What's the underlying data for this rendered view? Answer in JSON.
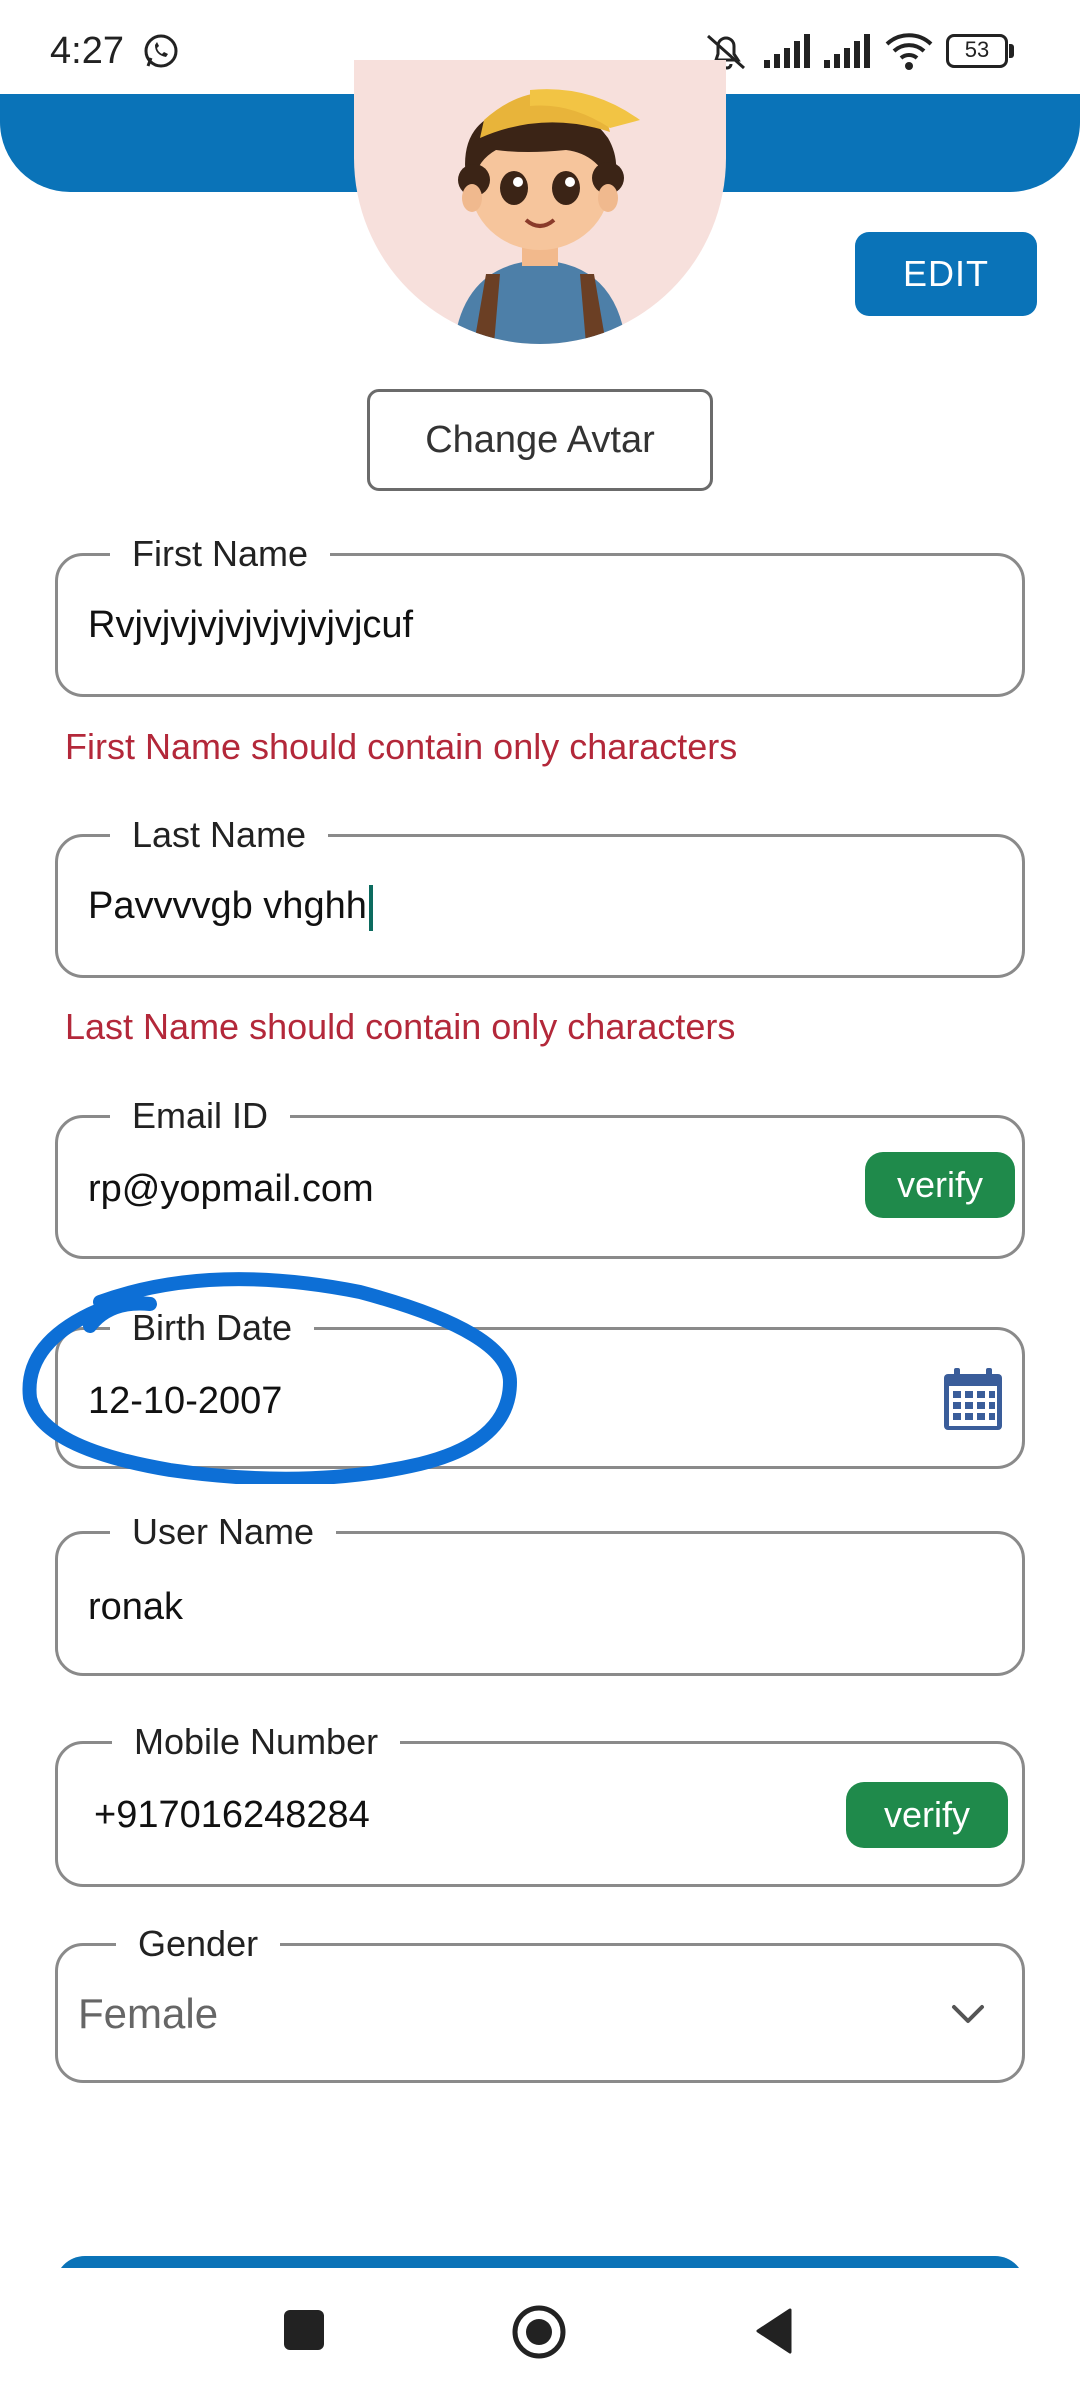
{
  "status_bar": {
    "time": "4:27",
    "battery": "53",
    "icons": [
      "whatsapp-icon",
      "mute-icon",
      "signal-icon",
      "signal-icon",
      "wifi-icon",
      "battery-icon"
    ]
  },
  "header": {
    "edit_label": "EDIT",
    "change_avatar_label": "Change Avtar",
    "accent_color": "#0a73b8"
  },
  "form": {
    "first_name": {
      "label": "First Name",
      "value": "Rvjvjvjvjvjvjvjvjvjcuf",
      "error": "First Name should contain only characters"
    },
    "last_name": {
      "label": "Last Name",
      "value": "Pavvvvgb vhghh",
      "error": "Last Name should contain only characters"
    },
    "email": {
      "label": "Email ID",
      "value": "rp@yopmail.com",
      "verify_label": "verify"
    },
    "birth_date": {
      "label": "Birth Date",
      "value": "12-10-2007"
    },
    "user_name": {
      "label": "User Name",
      "value": "ronak"
    },
    "mobile": {
      "label": "Mobile Number",
      "value": "+917016248284",
      "verify_label": "verify"
    },
    "gender": {
      "label": "Gender",
      "value": "Female"
    }
  },
  "colors": {
    "primary": "#0a73b8",
    "error": "#b3283a",
    "verify": "#1f8a4b"
  }
}
